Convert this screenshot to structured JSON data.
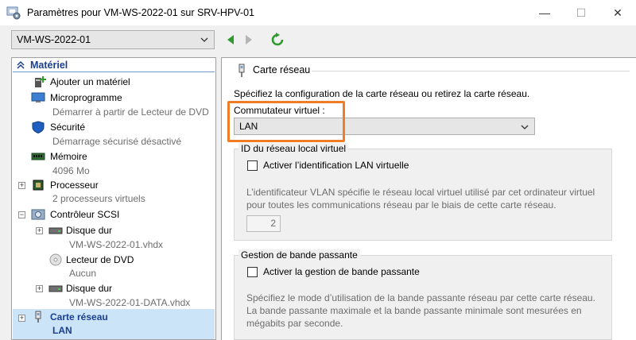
{
  "window": {
    "title": "Paramètres pour VM-WS-2022-01 sur SRV-HPV-01",
    "min_glyph": "—",
    "max_glyph": "☐",
    "close_glyph": "✕"
  },
  "toolbar": {
    "vm_selected": "VM-WS-2022-01"
  },
  "sidebar": {
    "section": "Matériel",
    "items": [
      {
        "label": "Ajouter un matériel",
        "sub": ""
      },
      {
        "label": "Microprogramme",
        "sub": "Démarrer à partir de Lecteur de DVD"
      },
      {
        "label": "Sécurité",
        "sub": "Démarrage sécurisé désactivé"
      },
      {
        "label": "Mémoire",
        "sub": "4096 Mo"
      },
      {
        "label": "Processeur",
        "sub": "2 processeurs virtuels"
      },
      {
        "label": "Contrôleur SCSI",
        "sub": ""
      },
      {
        "label": "Disque dur",
        "sub": "VM-WS-2022-01.vhdx"
      },
      {
        "label": "Lecteur de DVD",
        "sub": "Aucun"
      },
      {
        "label": "Disque dur",
        "sub": "VM-WS-2022-01-DATA.vhdx"
      },
      {
        "label": "Carte réseau",
        "sub": "LAN"
      }
    ],
    "expander_plus": "+",
    "expander_minus": "−"
  },
  "main": {
    "header": "Carte réseau",
    "description": "Spécifiez la configuration de la carte réseau ou retirez la carte réseau.",
    "switch_label": "Commutateur virtuel :",
    "switch_value": "LAN",
    "vlan": {
      "title": "ID du réseau local virtuel",
      "checkbox": "Activer l’identification LAN virtuelle",
      "help_line1": "L’identificateur VLAN spécifie le réseau local virtuel utilisé par cet ordinateur virtuel",
      "help_line2": "pour toutes les communications réseau par le biais de cette carte réseau.",
      "value": "2"
    },
    "bandwidth": {
      "title": "Gestion de bande passante",
      "checkbox": "Activer la gestion de bande passante",
      "help_line1": "Spécifiez le mode d’utilisation de la bande passante réseau par cette carte réseau.",
      "help_line2": "La bande passante maximale et la bande passante minimale sont mesurées en",
      "help_line3": "mégabits par seconde."
    }
  },
  "colors": {
    "highlight": "#f07c26",
    "selection": "#cce4f7",
    "nav_green": "#2e9b2e",
    "link_blue": "#1a3f8e"
  },
  "icons": [
    "settings-app-icon",
    "chevron-down-icon",
    "back-arrow-icon",
    "forward-arrow-icon",
    "refresh-icon",
    "collapse-icon",
    "add-hardware-icon",
    "firmware-icon",
    "shield-icon",
    "memory-icon",
    "processor-icon",
    "scsi-controller-icon",
    "hard-disk-icon",
    "dvd-icon",
    "network-adapter-icon"
  ]
}
